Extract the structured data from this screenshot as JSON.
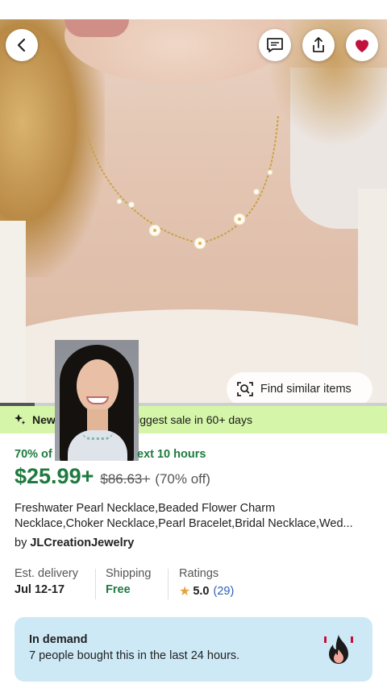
{
  "hero": {
    "find_similar_label": "Find similar items",
    "progress": 0.09
  },
  "top_actions": {
    "back_icon": "chevron-left-icon",
    "message_icon": "message-icon",
    "share_icon": "share-icon",
    "favorite_icon": "heart-icon",
    "favorite_color": "#c1123e"
  },
  "sale_banner": {
    "icon": "sparkle-icon",
    "bold_text": "New",
    "text": "Biggest sale in 60+ days",
    "background": "#d5f5a9"
  },
  "pricing": {
    "discount_left": "70% of",
    "discount_right": "ext 10 hours",
    "price": "$25.99+",
    "original_price": "$86.63+",
    "percent_off": "(70% off)",
    "accent": "#1f7a3f"
  },
  "product": {
    "title_line1": "Freshwater Pearl Necklace,Beaded Flower Charm",
    "title_line2": "Necklace,Choker Necklace,Pearl Bracelet,Bridal Necklace,Wed...",
    "shop_prefix": "by",
    "shop_name": "JLCreationJewelry"
  },
  "details": {
    "delivery_label": "Est. delivery",
    "delivery_value": "Jul 12-17",
    "shipping_label": "Shipping",
    "shipping_value": "Free",
    "ratings_label": "Ratings",
    "rating_value": "5.0",
    "rating_count": "(29)"
  },
  "demand": {
    "heading": "In demand",
    "text": "7 people bought this in the last 24 hours.",
    "icon": "fire-icon"
  }
}
